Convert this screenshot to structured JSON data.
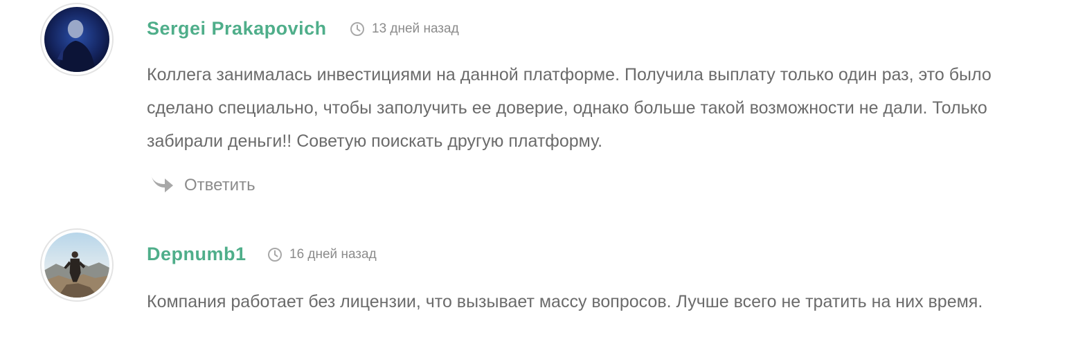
{
  "comments": [
    {
      "author": "Sergei Prakapovich",
      "time": "13 дней назад",
      "text": "Коллега занималась инвестициями на данной платформе. Получила выплату только один раз, это было сделано специально, чтобы заполучить ее доверие, однако больше такой возможности не дали. Только забирали деньги!! Советую поискать другую платформу.",
      "reply_label": "Ответить",
      "avatar_icon": "user-photo-dark-blue"
    },
    {
      "author": "Depnumb1",
      "time": "16 дней назад",
      "text": "Компания работает без лицензии, что вызывает массу вопросов. Лучше всего не тратить на них время.",
      "avatar_icon": "user-photo-mountain"
    }
  ],
  "colors": {
    "author": "#4fae8a",
    "text": "#6b6b6b",
    "meta": "#8b8b8b",
    "icon": "#a8a8a8"
  },
  "icons": {
    "time": "clock-icon",
    "reply": "reply-arrow-icon"
  }
}
